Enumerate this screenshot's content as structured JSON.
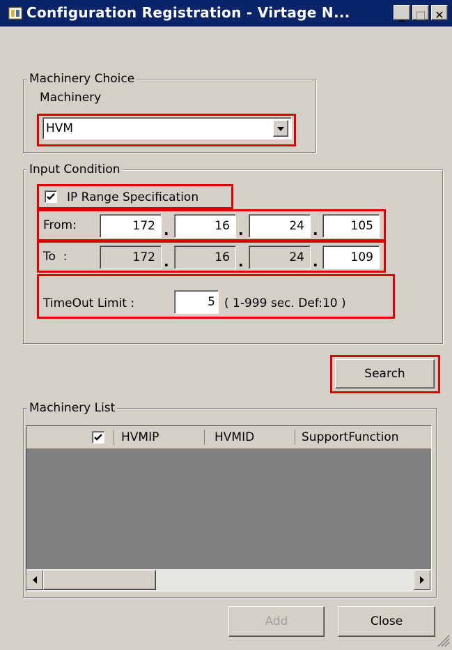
{
  "window": {
    "title": "Configuration Registration - Virtage N...",
    "minimize_glyph": "_",
    "maximize_glyph": "□",
    "close_glyph": "✕"
  },
  "machinery_choice": {
    "group_label": "Machinery Choice",
    "field_label": "Machinery",
    "selected_value": "HVM"
  },
  "input_condition": {
    "group_label": "Input Condition",
    "ip_range_label": "IP Range Specification",
    "ip_range_checked": true,
    "from_label": "From:",
    "from_octets": [
      "172",
      "16",
      "24",
      "105"
    ],
    "to_label": "To  :",
    "to_octets": [
      "172",
      "16",
      "24",
      "109"
    ],
    "dot": ".",
    "timeout_label": "TimeOut Limit :",
    "timeout_value": "5",
    "timeout_hint": "( 1-999 sec. Def:10 )"
  },
  "search_button": "Search",
  "machinery_list": {
    "group_label": "Machinery List",
    "header_checked": true,
    "columns": [
      "HVMIP",
      "HVMID",
      "SupportFunction"
    ]
  },
  "footer": {
    "add_label": "Add",
    "close_label": "Close"
  },
  "colors": {
    "titlebar": "#0a246a",
    "highlight_border": "#e00000",
    "window_face": "#d4d0c8",
    "list_empty": "#808080"
  }
}
